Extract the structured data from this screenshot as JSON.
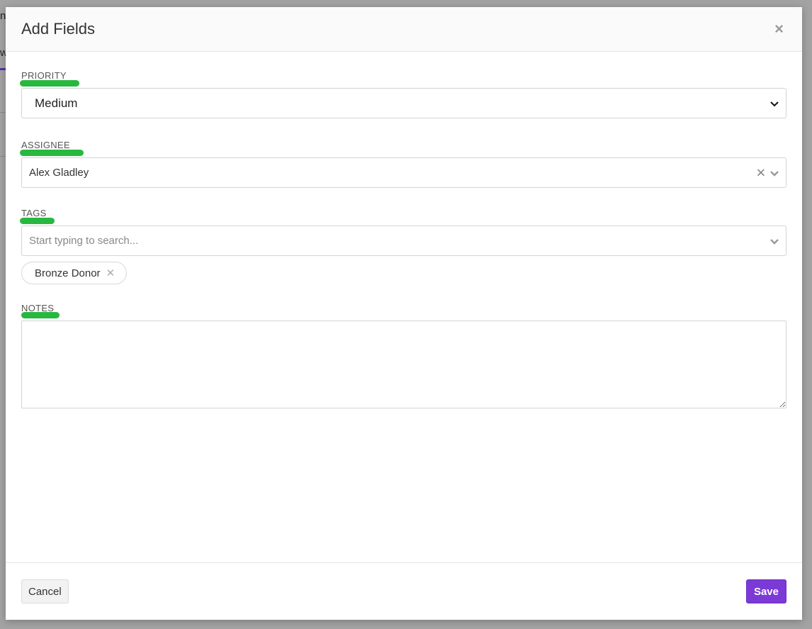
{
  "background": {
    "fragment_1": "n",
    "fragment_2": "w"
  },
  "modal": {
    "title": "Add Fields",
    "close_icon": "×"
  },
  "fields": {
    "priority": {
      "label": "PRIORITY",
      "value": "Medium"
    },
    "assignee": {
      "label": "ASSIGNEE",
      "value": "Alex Gladley",
      "clear_icon": "✕"
    },
    "tags": {
      "label": "TAGS",
      "placeholder": "Start typing to search...",
      "selected": [
        {
          "label": "Bronze Donor",
          "remove_icon": "✕"
        }
      ]
    },
    "notes": {
      "label": "NOTES",
      "value": ""
    }
  },
  "footer": {
    "cancel_label": "Cancel",
    "save_label": "Save"
  },
  "colors": {
    "accent": "#7b3ad6",
    "highlight_marker": "#28b83f"
  }
}
